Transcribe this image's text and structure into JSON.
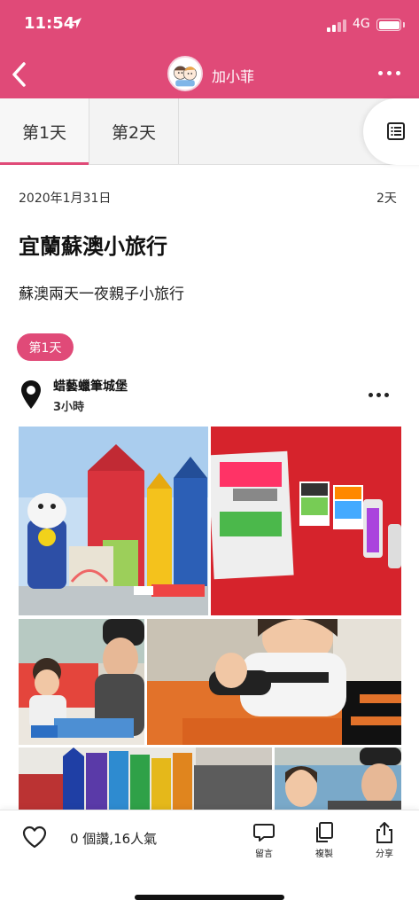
{
  "status_bar": {
    "time": "11:54",
    "network": "4G"
  },
  "nav": {
    "title": "加小菲",
    "icons": [
      "back-arrow-icon",
      "avatar",
      "more-icon"
    ]
  },
  "tabs": [
    {
      "label": "第1天",
      "active": true
    },
    {
      "label": "第2天",
      "active": false
    }
  ],
  "trip": {
    "date": "2020年1月31日",
    "duration": "2天",
    "title": "宜蘭蘇澳小旅行",
    "subtitle": "蘇澳兩天一夜親子小旅行",
    "day_badge": "第1天"
  },
  "place": {
    "name": "蜡藝蠟筆城堡",
    "time": "3小時"
  },
  "bottom_bar": {
    "stats": "0 個讚,16人氣",
    "actions": [
      {
        "label": "留言",
        "icon": "comment-icon"
      },
      {
        "label": "複製",
        "icon": "copy-icon"
      },
      {
        "label": "分享",
        "icon": "share-icon"
      }
    ]
  },
  "colors": {
    "accent": "#e04a78",
    "tab_bg": "#f3f3f3"
  }
}
